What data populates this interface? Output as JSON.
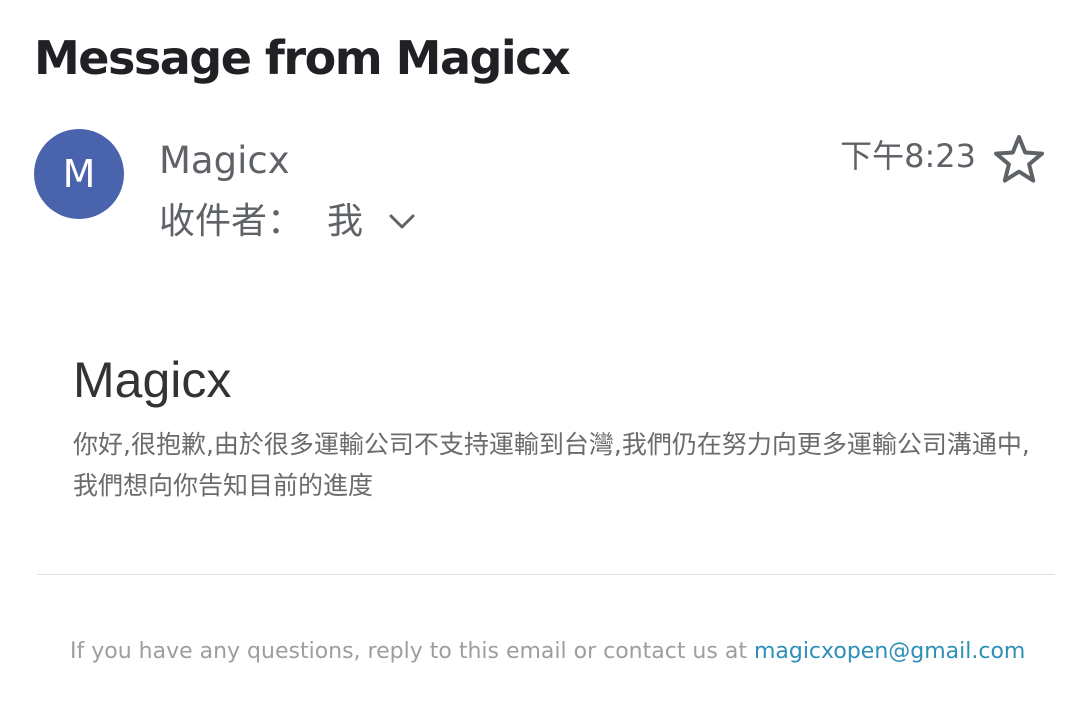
{
  "email": {
    "subject": "Message from Magicx",
    "sender": {
      "avatar_initial": "M",
      "name": "Magicx",
      "avatar_color": "#4a63ad"
    },
    "recipient": {
      "label": "收件者：",
      "value": "我",
      "expand_icon": "chevron-down-icon"
    },
    "time": "下午8:23",
    "star_icon": "star-outline-icon",
    "body": {
      "heading": "Magicx",
      "text": "你好,很抱歉,由於很多運輸公司不支持運輸到台灣,我們仍在努力向更多運輸公司溝通中,我們想向你告知目前的進度"
    },
    "footer": {
      "text": "If you have any questions, reply to this email or contact us at ",
      "email_link": "magicxopen@gmail.com",
      "link_color": "#2e8fb8"
    }
  }
}
